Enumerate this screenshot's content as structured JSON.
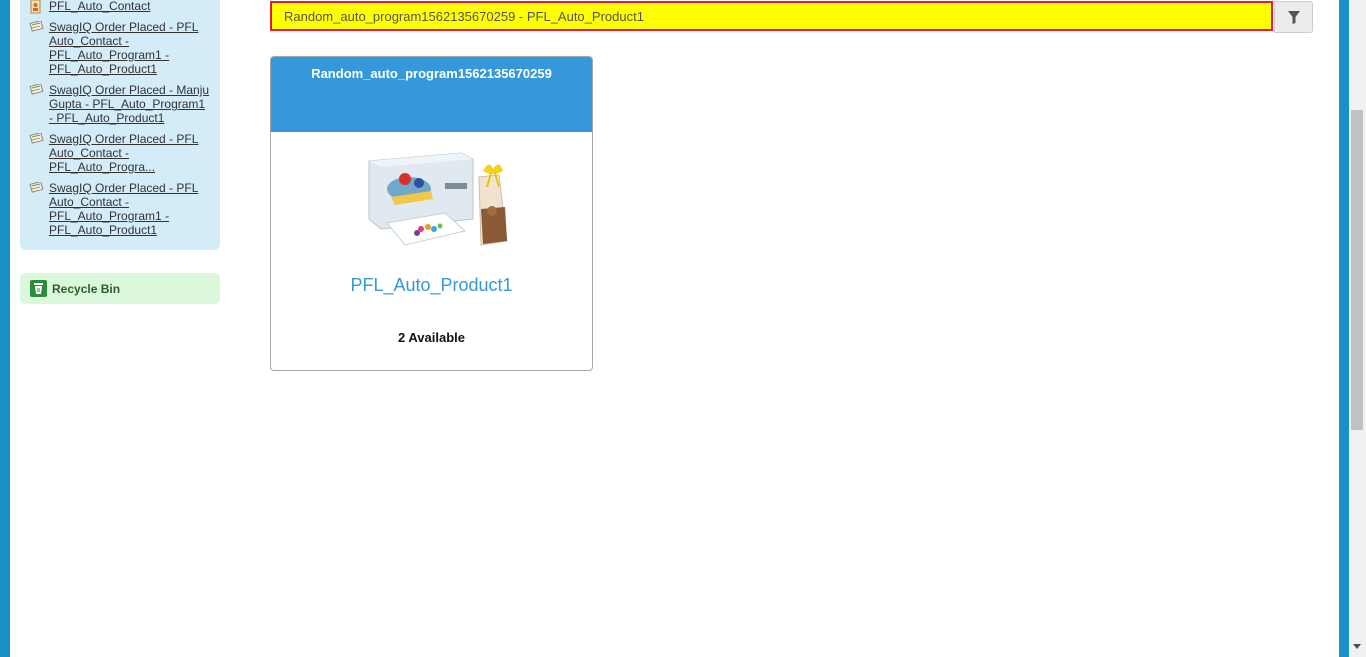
{
  "sidebar": {
    "recent_items": [
      {
        "label": "PFL_Auto_Contact"
      },
      {
        "label": "SwagIQ Order Placed - PFL Auto_Contact - PFL_Auto_Program1 - PFL_Auto_Product1"
      },
      {
        "label": "SwagIQ Order Placed - Manju Gupta - PFL_Auto_Program1 - PFL_Auto_Product1"
      },
      {
        "label": "SwagIQ Order Placed - PFL Auto_Contact - PFL_Auto_Progra..."
      },
      {
        "label": "SwagIQ Order Placed - PFL Auto_Contact - PFL_Auto_Program1 - PFL_Auto_Product1"
      }
    ],
    "recycle_bin_label": "Recycle Bin"
  },
  "search": {
    "value": "Random_auto_program1562135670259 - PFL_Auto_Product1",
    "filter_icon": "filter-icon"
  },
  "card": {
    "program_name": "Random_auto_program1562135670259",
    "product_name": "PFL_Auto_Product1",
    "availability": "2 Available",
    "image_icon": "product-kit-image"
  },
  "colors": {
    "frame": "#1b8fc7",
    "sidebar_panel": "#d3ecf8",
    "recycle_bin_bg": "#dcf8dc",
    "search_bg": "#ffff00",
    "search_border": "#e01b3c",
    "card_header": "#3498db"
  }
}
